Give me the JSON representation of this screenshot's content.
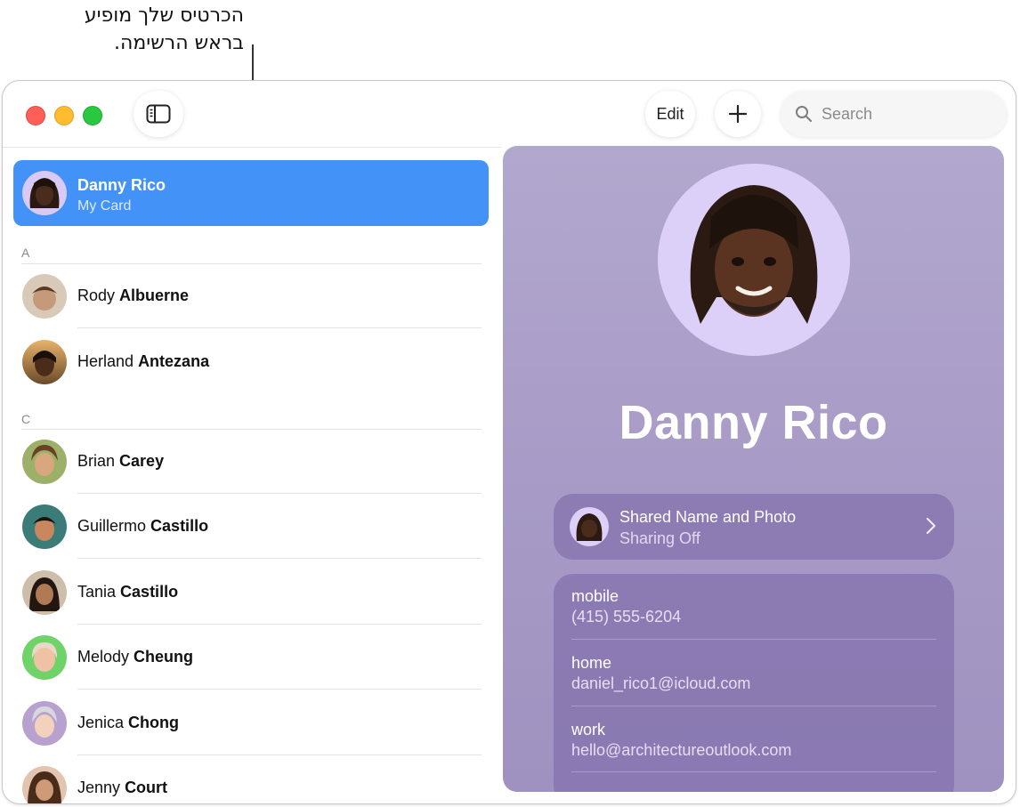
{
  "callout": {
    "line1": "הכרטיס שלך מופיע",
    "line2": "בראש הרשימה."
  },
  "toolbar": {
    "edit_label": "Edit",
    "add_label": "+",
    "search_placeholder": "Search"
  },
  "my_card": {
    "name": "Danny Rico",
    "subtitle": "My Card"
  },
  "sections": [
    {
      "letter": "A",
      "contacts": [
        {
          "first": "Rody",
          "last": "Albuerne"
        },
        {
          "first": "Herland",
          "last": "Antezana"
        }
      ]
    },
    {
      "letter": "C",
      "contacts": [
        {
          "first": "Brian",
          "last": "Carey"
        },
        {
          "first": "Guillermo",
          "last": "Castillo"
        },
        {
          "first": "Tania",
          "last": "Castillo"
        },
        {
          "first": "Melody",
          "last": "Cheung"
        },
        {
          "first": "Jenica",
          "last": "Chong"
        },
        {
          "first": "Jenny",
          "last": "Court"
        }
      ]
    }
  ],
  "detail": {
    "name": "Danny Rico",
    "share_title": "Shared Name and Photo",
    "share_status": "Sharing Off",
    "fields": [
      {
        "label": "mobile",
        "value": "(415) 555-6204"
      },
      {
        "label": "home",
        "value": "daniel_rico1@icloud.com"
      },
      {
        "label": "work",
        "value": "hello@architectureoutlook.com"
      }
    ]
  },
  "colors": {
    "selection": "#4392f7",
    "detail_bg": "#a99dc8"
  }
}
